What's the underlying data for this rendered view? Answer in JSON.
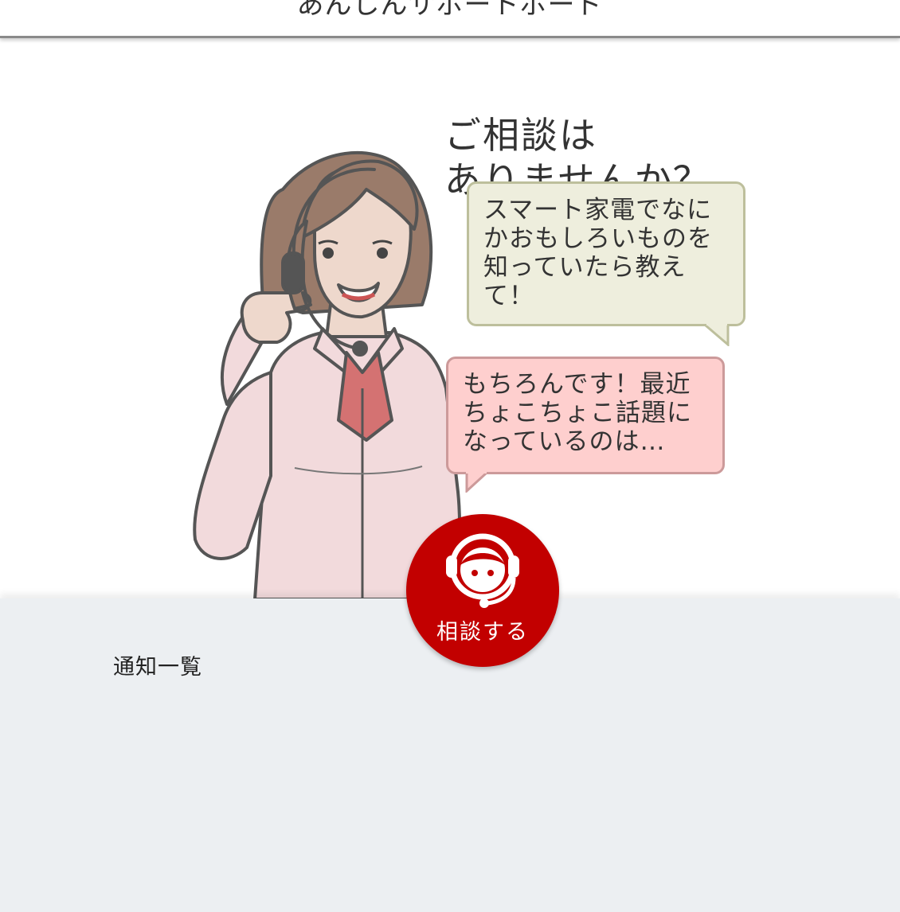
{
  "header": {
    "title": "あんしんサポートボード"
  },
  "hero": {
    "question_lines": [
      "ご相談は",
      "ありませんか？"
    ],
    "bubble_user_lines": [
      "スマート家電でなに",
      "かおもしろいものを",
      "知っていたら教え",
      "て！"
    ],
    "bubble_agent_lines": [
      "もちろんです！最近",
      "ちょこちょこ話題に",
      "なっているのは…"
    ],
    "bubble_user_color": "#eeeedd",
    "bubble_agent_color": "#fecfce"
  },
  "consult_button": {
    "label": "相談する",
    "icon": "operator-headset-icon",
    "color": "#c20000"
  },
  "notifications": {
    "title": "通知一覧"
  }
}
